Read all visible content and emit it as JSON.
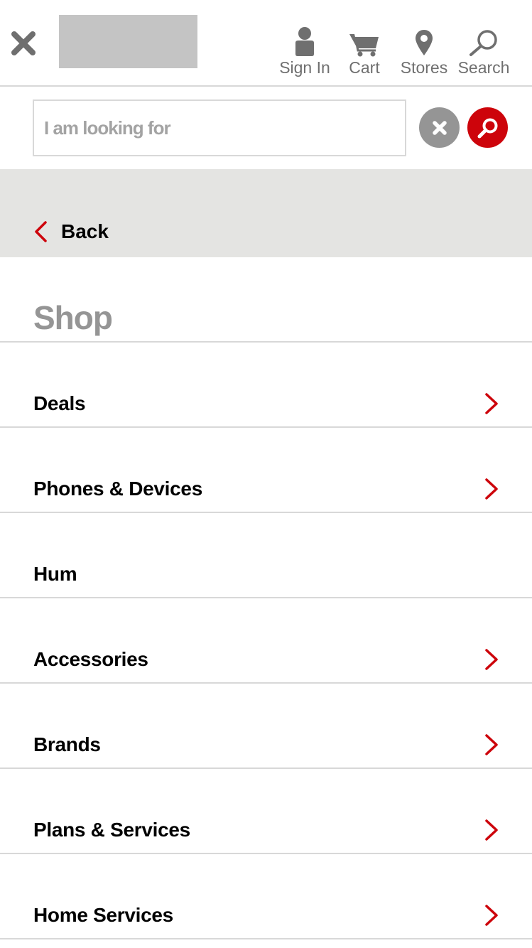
{
  "header": {
    "close_icon": "close-icon",
    "nav": {
      "sign_in": "Sign In",
      "cart": "Cart",
      "stores": "Stores",
      "search": "Search"
    }
  },
  "search": {
    "placeholder": "I am looking for",
    "value": ""
  },
  "back": {
    "label": "Back"
  },
  "section": {
    "title": "Shop"
  },
  "menu": {
    "items": [
      {
        "label": "Deals",
        "has_submenu": true
      },
      {
        "label": "Phones & Devices",
        "has_submenu": true
      },
      {
        "label": "Hum",
        "has_submenu": false
      },
      {
        "label": "Accessories",
        "has_submenu": true
      },
      {
        "label": "Brands",
        "has_submenu": true
      },
      {
        "label": "Plans & Services",
        "has_submenu": true
      },
      {
        "label": "Home Services",
        "has_submenu": true
      }
    ]
  },
  "colors": {
    "accent": "#cd040b",
    "icon_gray": "#6f6f6f",
    "placeholder_gray": "#a3a3a3",
    "clear_button": "#959595",
    "back_bar_bg": "#e4e4e2",
    "divider": "#d8d8d8",
    "logo_placeholder": "#c4c4c4"
  }
}
